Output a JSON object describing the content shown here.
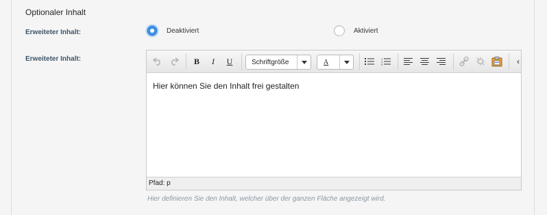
{
  "section": {
    "title": "Optionaler Inhalt"
  },
  "field1": {
    "label": "Erweiteter Inhalt:",
    "options": [
      {
        "label": "Deaktiviert",
        "checked": true
      },
      {
        "label": "Aktiviert",
        "checked": false
      }
    ]
  },
  "field2": {
    "label": "Erweiteter Inhalt:",
    "toolbar": {
      "bold": "B",
      "italic": "I",
      "underline": "U",
      "font_size_select": "Schriftgröße",
      "text_color_letter": "A"
    },
    "content_text": "Hier können Sie den Inhalt frei gestalten",
    "path_text": "Pfad: p",
    "hint": "Hier definieren Sie den Inhalt, welcher über der ganzen Fläche angezeigt wird."
  },
  "colors": {
    "label": "#3e5468",
    "radio_checked": "#3c8ee2",
    "hint": "#8a97a6"
  },
  "icons": [
    "undo-icon",
    "redo-icon",
    "bullet-list-icon",
    "numbered-list-icon",
    "align-left-icon",
    "align-center-icon",
    "align-right-icon",
    "link-icon",
    "unlink-icon",
    "paste-icon",
    "more-icon"
  ]
}
